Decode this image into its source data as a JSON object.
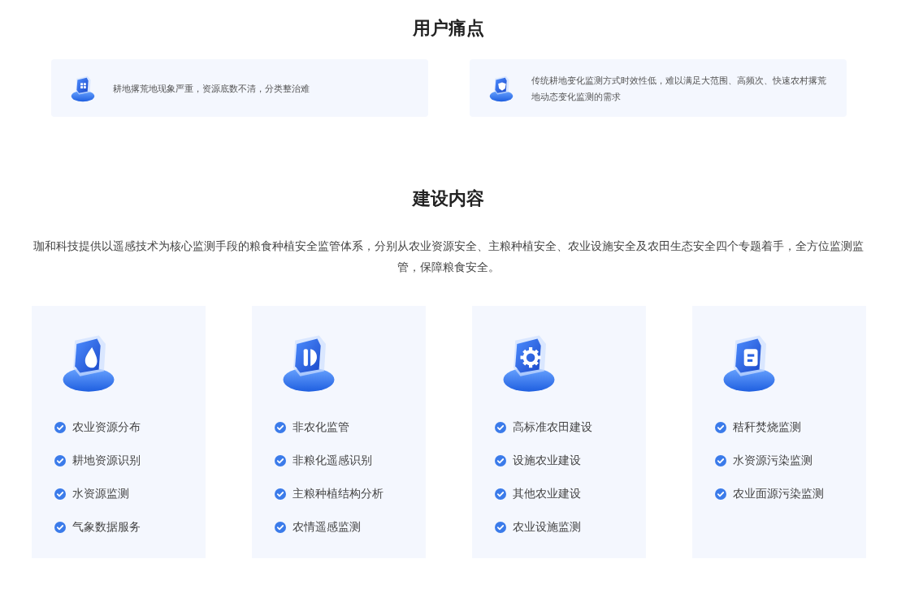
{
  "pain_points": {
    "title": "用户痛点",
    "cards": [
      {
        "text": "耕地撂荒地现象严重，资源底数不清，分类整治难"
      },
      {
        "text": "传统耕地变化监测方式时效性低，难以满足大范围、高频次、快速农村撂荒地动态变化监测的需求"
      }
    ]
  },
  "construction": {
    "title": "建设内容",
    "description": "珈和科技提供以遥感技术为核心监测手段的粮食种植安全监管体系，分别从农业资源安全、主粮种植安全、农业设施安全及农田生态安全四个专题着手，全方位监测监管，保障粮食安全。",
    "cards": [
      {
        "items": [
          "农业资源分布",
          "耕地资源识别",
          "水资源监测",
          "气象数据服务"
        ]
      },
      {
        "items": [
          "非农化监管",
          "非粮化遥感识别",
          "主粮种植结构分析",
          "农情遥感监测"
        ]
      },
      {
        "items": [
          "高标准农田建设",
          "设施农业建设",
          "其他农业建设",
          "农业设施监测"
        ]
      },
      {
        "items": [
          "秸秆焚烧监测",
          "水资源污染监测",
          "农业面源污染监测"
        ]
      }
    ]
  }
}
